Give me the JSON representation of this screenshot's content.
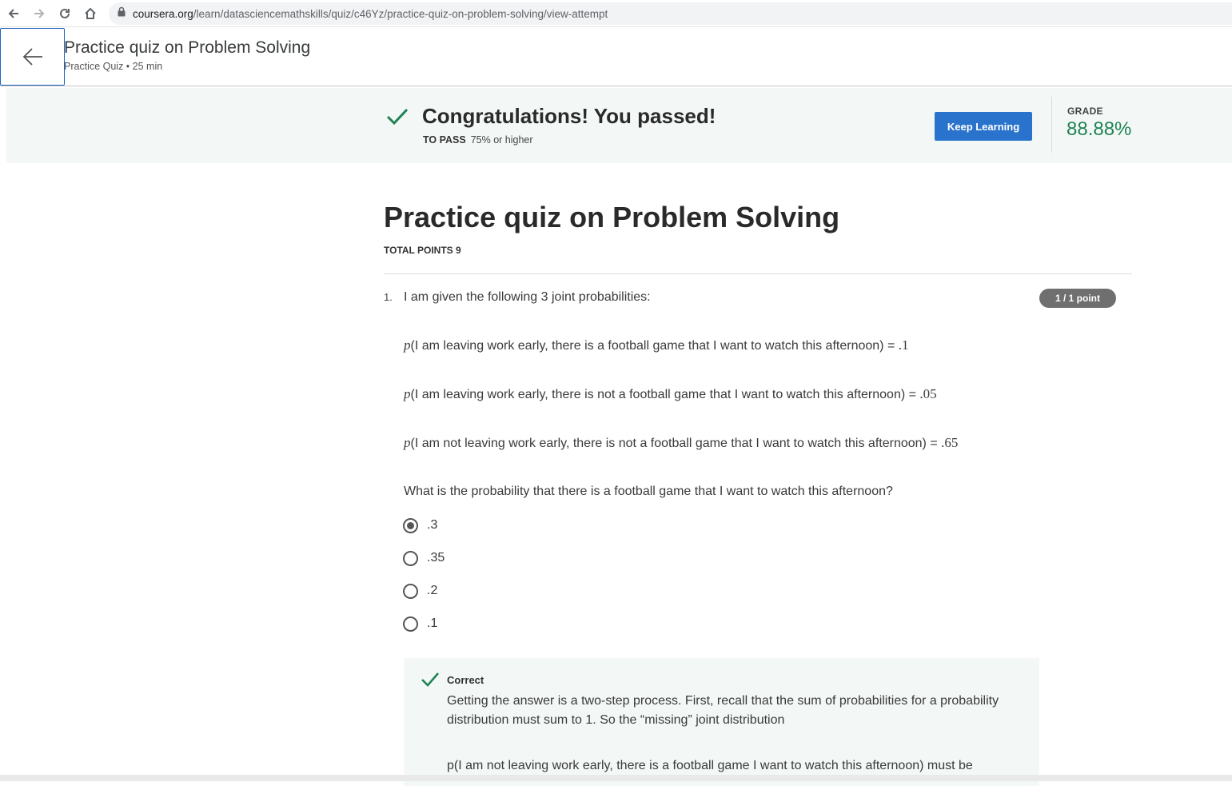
{
  "browser": {
    "url_host": "coursera.org",
    "url_path": "/learn/datasciencemathskills/quiz/c46Yz/practice-quiz-on-problem-solving/view-attempt",
    "icons": [
      "back-arrow-icon",
      "forward-arrow-icon",
      "reload-icon",
      "home-icon",
      "lock-icon"
    ]
  },
  "header": {
    "title": "Practice quiz on Problem Solving",
    "subtitle": "Practice Quiz • 25 min",
    "back_icon": "arrow-left-icon"
  },
  "banner": {
    "title": "Congratulations! You passed!",
    "to_pass_label": "TO PASS",
    "to_pass_value": "75% or higher",
    "keep_learning_label": "Keep Learning",
    "grade_label": "GRADE",
    "grade_value": "88.88%",
    "accent_color": "#1f8354",
    "button_color": "#2a73cc"
  },
  "quiz": {
    "title": "Practice quiz on Problem Solving",
    "total_points": "TOTAL POINTS 9",
    "question": {
      "number": "1.",
      "prompt": "I am given the following 3 joint probabilities:",
      "points": "1 / 1 point",
      "probabilities": [
        {
          "p": "p",
          "text": "(I am leaving work early, there is a football game that I want to watch this afternoon) = ",
          "value": ".1"
        },
        {
          "p": "p",
          "text": "(I am leaving work early, there is not a football game that I want to watch this afternoon) = ",
          "value": ".05"
        },
        {
          "p": "p",
          "text": "(I am not leaving work early, there is not a football game that I want to watch this afternoon) = ",
          "value": ".65"
        }
      ],
      "question_text": "What is the probability that there is a football game that I want to watch this afternoon?",
      "options": [
        {
          "label": ".3",
          "selected": true
        },
        {
          "label": ".35",
          "selected": false
        },
        {
          "label": ".2",
          "selected": false
        },
        {
          "label": ".1",
          "selected": false
        }
      ],
      "feedback": {
        "label": "Correct",
        "text": "Getting the answer is a two-step process. First, recall that the sum of probabilities for a probability distribution must sum to 1. So the “missing” joint distribution",
        "text2": "p(I am not leaving work early, there is a football game I want to watch this afternoon) must be"
      }
    }
  }
}
